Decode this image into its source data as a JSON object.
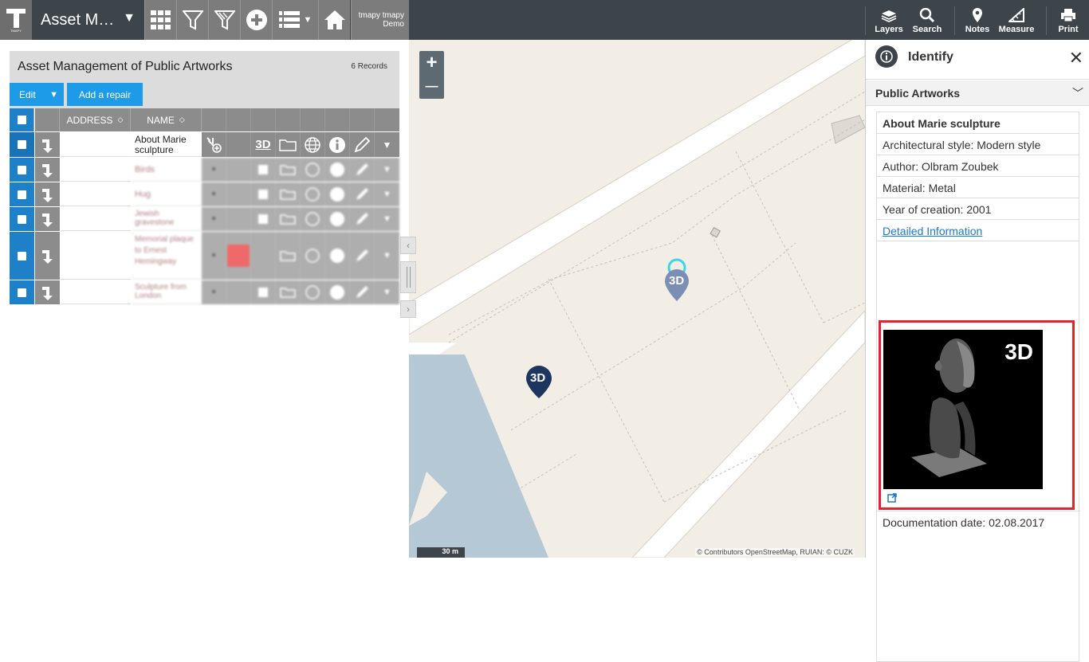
{
  "app": {
    "title": "Asset M…",
    "user_name": "tmapy tmapy",
    "user_org": "Demo"
  },
  "toolbar_right": {
    "layers": "Layers",
    "search": "Search",
    "notes": "Notes",
    "measure": "Measure",
    "print": "Print"
  },
  "panel": {
    "title": "Asset Management of Public Artworks",
    "records": "6 Records",
    "edit_label": "Edit",
    "add_repair_label": "Add a repair",
    "columns": {
      "address": "ADDRESS",
      "name": "NAME"
    },
    "rows": [
      {
        "name": "About Marie sculpture"
      },
      {
        "name": "Birds"
      },
      {
        "name": "Hug"
      },
      {
        "name": "Jewish gravestone"
      },
      {
        "name": "Memorial plaque to Ernest Hemingway"
      },
      {
        "name": "Sculpture from London"
      }
    ],
    "icon_3d_label": "3D"
  },
  "map": {
    "zoom_in": "+",
    "zoom_out": "—",
    "scale": "30 m",
    "attribution": "© Contributors OpenStreetMap, RUIAN: © CUZK",
    "marker_label": "3D"
  },
  "identify": {
    "title": "Identify",
    "layer": "Public Artworks",
    "object_title": "About Marie sculpture",
    "fields": [
      "Architectural style: Modern style",
      "Author: Olbram Zoubek",
      "Material: Metal",
      "Year of creation: 2001"
    ],
    "link": "Detailed Information",
    "thumb_label": "3D",
    "documentation_date": "Documentation date: 02.08.2017"
  }
}
